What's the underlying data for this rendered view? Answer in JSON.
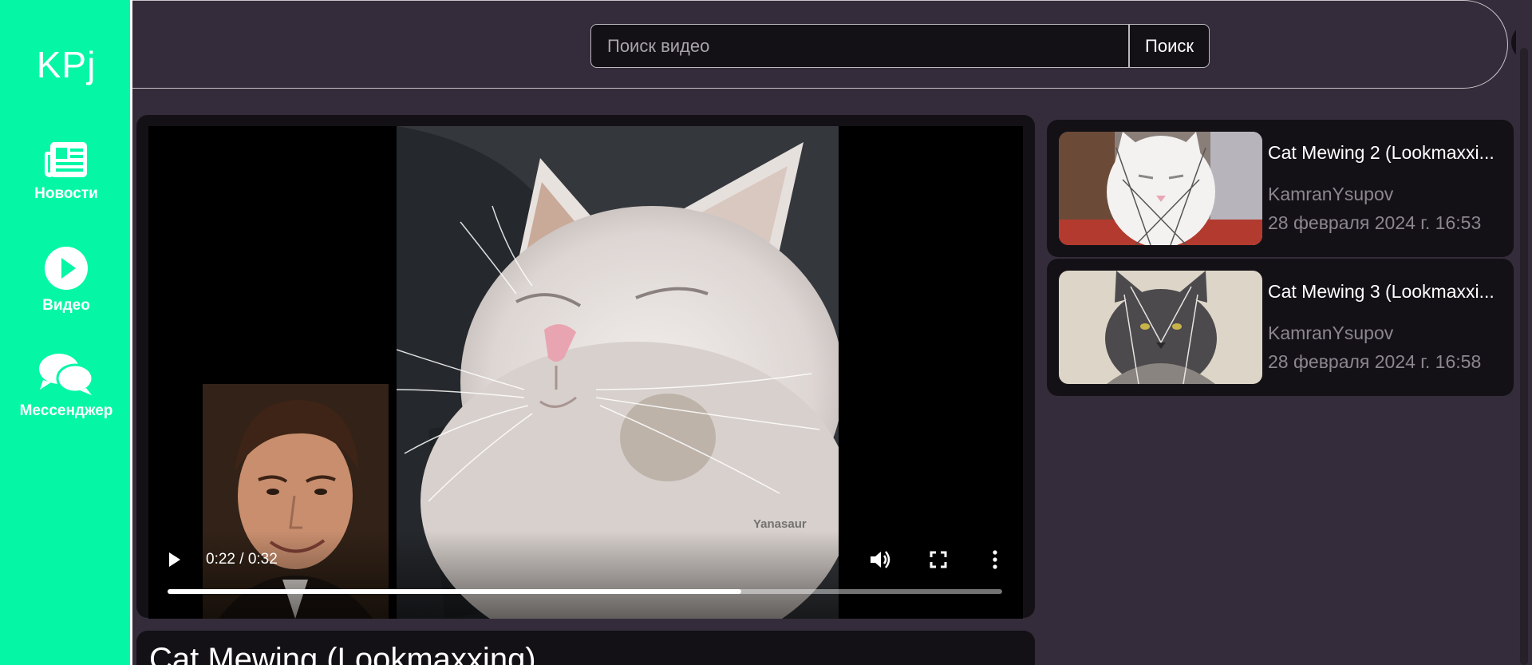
{
  "sidebar": {
    "logo": "KPj",
    "items": [
      {
        "label": "Новости",
        "icon": "newspaper-icon"
      },
      {
        "label": "Видео",
        "icon": "play-circle-icon"
      },
      {
        "label": "Мессенджер",
        "icon": "chat-bubbles-icon"
      }
    ]
  },
  "header": {
    "search_placeholder": "Поиск видео",
    "search_value": "",
    "search_button": "Поиск",
    "add_icon": "plus-icon",
    "avatar_icon": "user-avatar"
  },
  "player": {
    "time": "0:22 / 0:32",
    "progress": 0.6875,
    "watermark": "Yanasaur",
    "play_icon": "play-icon",
    "volume_icon": "volume-icon",
    "fullscreen_icon": "fullscreen-icon",
    "more_icon": "more-vertical-icon"
  },
  "video": {
    "title": "Cat Mewing (Lookmaxxing)"
  },
  "recommendations": [
    {
      "title": "Cat Mewing 2 (Lookmaxxi...",
      "author": "KamranYsupov",
      "date": "28 февраля 2024 г. 16:53"
    },
    {
      "title": "Cat Mewing 3 (Lookmaxxi...",
      "author": "KamranYsupov",
      "date": "28 февраля 2024 г. 16:58"
    }
  ],
  "colors": {
    "sidebar_bg": "#05f7a6",
    "page_bg": "#342c3a",
    "card_bg": "#141116"
  }
}
